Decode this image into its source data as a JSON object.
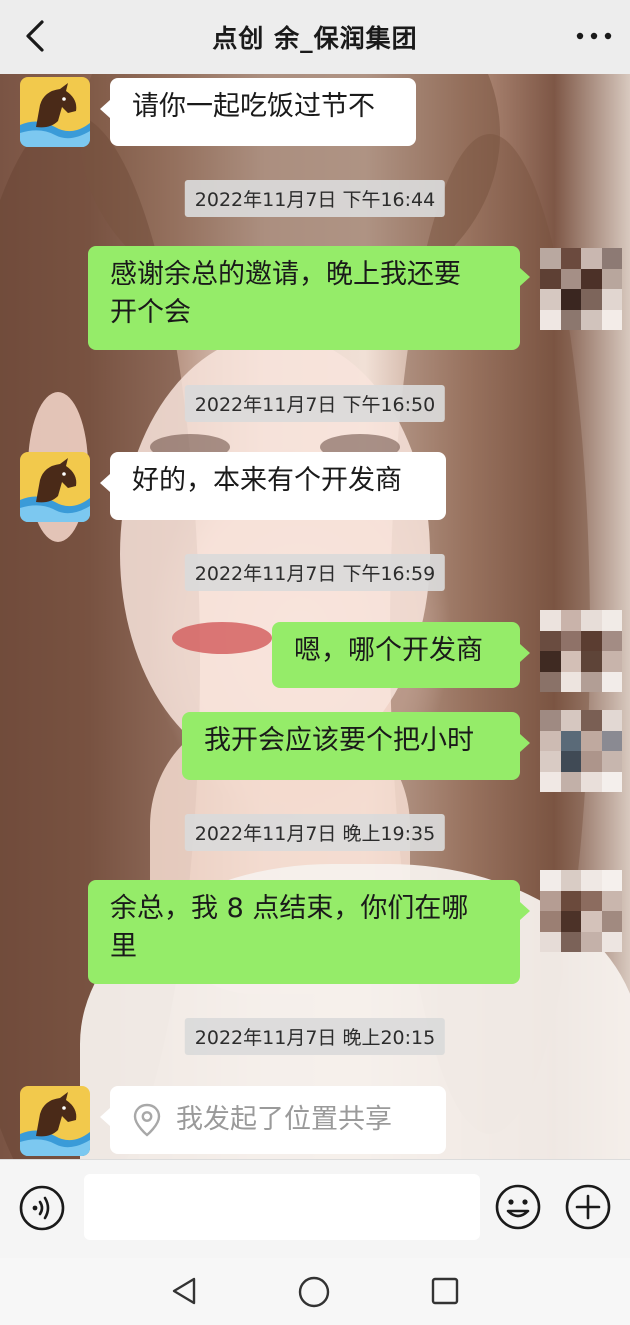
{
  "header": {
    "title": "点创  余_保润集团",
    "back_icon": "chevron-left-icon",
    "more_icon": "more-dots-icon"
  },
  "messages": [
    {
      "side": "left",
      "text": "请你一起吃饭过节不"
    },
    {
      "type": "timestamp",
      "text": "2022年11月7日 下午16:44"
    },
    {
      "side": "right",
      "text_line1": "感谢余总的邀请，晚上我还要",
      "text_line2": "开个会"
    },
    {
      "type": "timestamp",
      "text": "2022年11月7日 下午16:50"
    },
    {
      "side": "left",
      "text": "好的，本来有个开发商"
    },
    {
      "type": "timestamp",
      "text": "2022年11月7日 下午16:59"
    },
    {
      "side": "right",
      "text": "嗯，哪个开发商"
    },
    {
      "side": "right",
      "text": "我开会应该要个把小时"
    },
    {
      "type": "timestamp",
      "text": "2022年11月7日 晚上19:35"
    },
    {
      "side": "right",
      "text_line1": "余总，我 8 点结束，你们在哪",
      "text_line2": "里"
    },
    {
      "type": "timestamp",
      "text": "2022年11月7日 晚上20:15"
    },
    {
      "side": "left",
      "type": "location",
      "text": "我发起了位置共享",
      "icon": "location-pin-icon"
    }
  ],
  "input_bar": {
    "placeholder": "",
    "voice_icon": "voice-icon",
    "emoji_icon": "emoji-icon",
    "plus_icon": "plus-icon"
  },
  "colors": {
    "header_bg": "#ededed",
    "bubble_green": "#95ec69",
    "bubble_white": "#ffffff",
    "timestamp_bg": "#dadada"
  }
}
